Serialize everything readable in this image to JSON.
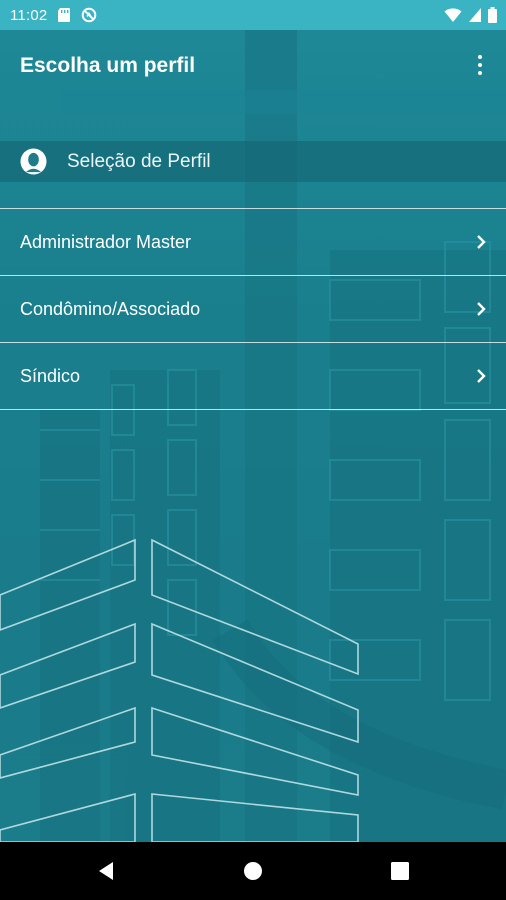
{
  "status_bar": {
    "time": "11:02",
    "left_icons": [
      "sd-card-icon",
      "no-sync-icon"
    ],
    "right_icons": [
      "wifi-icon",
      "signal-icon",
      "battery-icon"
    ]
  },
  "toolbar": {
    "title": "Escolha um perfil",
    "overflow_icon": "more-vert-icon"
  },
  "profile_section": {
    "icon": "person-circle-icon",
    "label": "Seleção de Perfil"
  },
  "profiles": [
    {
      "label": "Administrador Master",
      "icon": "chevron-right-icon"
    },
    {
      "label": "Condômino/Associado",
      "icon": "chevron-right-icon"
    },
    {
      "label": "Síndico",
      "icon": "chevron-right-icon"
    }
  ],
  "nav_bar": {
    "buttons": [
      "back-icon",
      "home-icon",
      "recents-icon"
    ]
  },
  "colors": {
    "status_bar": "#3ab3c3",
    "app_background": "#1a7f8e",
    "nav_bar": "#000000",
    "text": "#ffffff"
  }
}
